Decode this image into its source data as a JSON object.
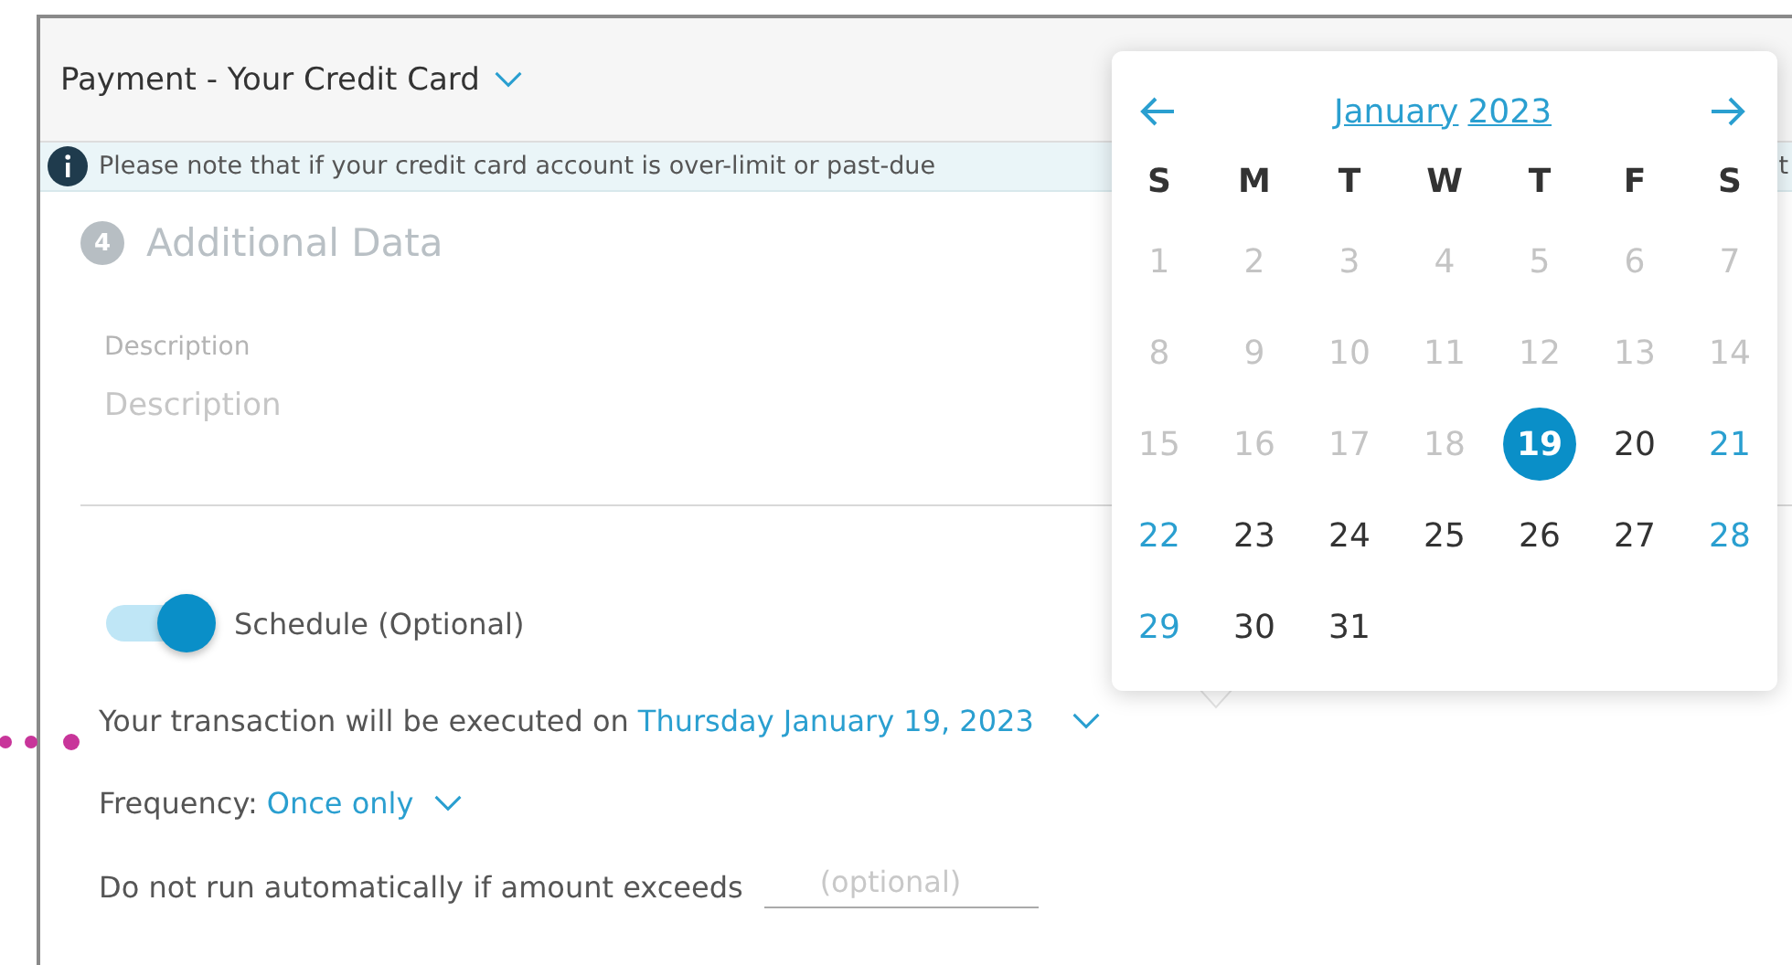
{
  "header": {
    "title": "Payment - Your Credit Card"
  },
  "notice": {
    "text": "Please note that if your credit card account is over-limit or past-due",
    "trailing": "t"
  },
  "section": {
    "step": "4",
    "title": "Additional Data"
  },
  "description": {
    "label": "Description",
    "placeholder": "Description"
  },
  "schedule": {
    "label": "Schedule (Optional)",
    "on": true
  },
  "execution": {
    "text": "Your transaction will be executed on",
    "date": "Thursday January 19, 2023"
  },
  "frequency": {
    "label": "Frequency:",
    "value": "Once only"
  },
  "limit": {
    "label": "Do not run automatically if amount exceeds",
    "placeholder": "(optional)"
  },
  "calendar": {
    "month": "January",
    "year": "2023",
    "weekdays": [
      "S",
      "M",
      "T",
      "W",
      "T",
      "F",
      "S"
    ],
    "days": [
      {
        "label": "1",
        "disabled": true,
        "selected": false,
        "weekend": true
      },
      {
        "label": "2",
        "disabled": true,
        "selected": false,
        "weekend": false
      },
      {
        "label": "3",
        "disabled": true,
        "selected": false,
        "weekend": false
      },
      {
        "label": "4",
        "disabled": true,
        "selected": false,
        "weekend": false
      },
      {
        "label": "5",
        "disabled": true,
        "selected": false,
        "weekend": false
      },
      {
        "label": "6",
        "disabled": true,
        "selected": false,
        "weekend": false
      },
      {
        "label": "7",
        "disabled": true,
        "selected": false,
        "weekend": true
      },
      {
        "label": "8",
        "disabled": true,
        "selected": false,
        "weekend": true
      },
      {
        "label": "9",
        "disabled": true,
        "selected": false,
        "weekend": false
      },
      {
        "label": "10",
        "disabled": true,
        "selected": false,
        "weekend": false
      },
      {
        "label": "11",
        "disabled": true,
        "selected": false,
        "weekend": false
      },
      {
        "label": "12",
        "disabled": true,
        "selected": false,
        "weekend": false
      },
      {
        "label": "13",
        "disabled": true,
        "selected": false,
        "weekend": false
      },
      {
        "label": "14",
        "disabled": true,
        "selected": false,
        "weekend": true
      },
      {
        "label": "15",
        "disabled": true,
        "selected": false,
        "weekend": true
      },
      {
        "label": "16",
        "disabled": true,
        "selected": false,
        "weekend": false
      },
      {
        "label": "17",
        "disabled": true,
        "selected": false,
        "weekend": false
      },
      {
        "label": "18",
        "disabled": true,
        "selected": false,
        "weekend": false
      },
      {
        "label": "19",
        "disabled": false,
        "selected": true,
        "weekend": false
      },
      {
        "label": "20",
        "disabled": false,
        "selected": false,
        "weekend": false
      },
      {
        "label": "21",
        "disabled": false,
        "selected": false,
        "weekend": true
      },
      {
        "label": "22",
        "disabled": false,
        "selected": false,
        "weekend": true
      },
      {
        "label": "23",
        "disabled": false,
        "selected": false,
        "weekend": false
      },
      {
        "label": "24",
        "disabled": false,
        "selected": false,
        "weekend": false
      },
      {
        "label": "25",
        "disabled": false,
        "selected": false,
        "weekend": false
      },
      {
        "label": "26",
        "disabled": false,
        "selected": false,
        "weekend": false
      },
      {
        "label": "27",
        "disabled": false,
        "selected": false,
        "weekend": false
      },
      {
        "label": "28",
        "disabled": false,
        "selected": false,
        "weekend": true
      },
      {
        "label": "29",
        "disabled": false,
        "selected": false,
        "weekend": true
      },
      {
        "label": "30",
        "disabled": false,
        "selected": false,
        "weekend": false
      },
      {
        "label": "31",
        "disabled": false,
        "selected": false,
        "weekend": false
      }
    ]
  }
}
